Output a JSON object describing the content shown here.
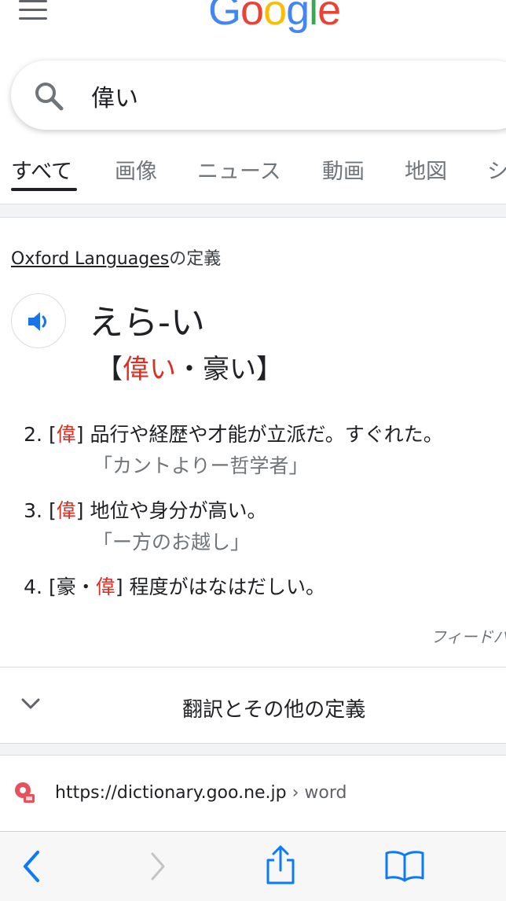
{
  "header": {
    "logo_letters": [
      "G",
      "o",
      "o",
      "g",
      "l",
      "e"
    ],
    "icons": {
      "menu": "menu-icon"
    }
  },
  "search": {
    "query": "偉い",
    "icon": "search-icon"
  },
  "tabs": [
    {
      "label": "すべて",
      "active": true
    },
    {
      "label": "画像"
    },
    {
      "label": "ニュース"
    },
    {
      "label": "動画"
    },
    {
      "label": "地図"
    },
    {
      "label": "シ"
    }
  ],
  "dictionary": {
    "source_name": "Oxford Languages",
    "source_suffix": "の定義",
    "headword": "えら-い",
    "kanji_open": "【",
    "kanji_primary": "偉い",
    "kanji_separator": "・",
    "kanji_secondary": "豪い",
    "kanji_close": "】",
    "speaker_icon": "speaker-icon",
    "senses": [
      {
        "num": "2.",
        "tags": [
          "偉"
        ],
        "definition": "品行や経歴や才能が立派だ。すぐれた。",
        "example": "「カントよりー哲学者」"
      },
      {
        "num": "3.",
        "tags": [
          "偉"
        ],
        "definition": "地位や身分が高い。",
        "example": "「ー方のお越し」"
      },
      {
        "num": "4.",
        "tags": [
          "豪",
          "偉"
        ],
        "tag_separator": "・",
        "definition": "程度がはなはだしい。"
      }
    ],
    "feedback": "フィードバ",
    "more_definitions": "翻訳とその他の定義",
    "colors": {
      "kanji_highlight": "#d93025"
    }
  },
  "result": {
    "url": "https://dictionary.goo.ne.jp",
    "breadcrumb": "› word"
  },
  "toolbar": {
    "icons": [
      "back-icon",
      "forward-icon",
      "share-icon",
      "bookmarks-icon"
    ],
    "accent": "#0a7aff"
  }
}
